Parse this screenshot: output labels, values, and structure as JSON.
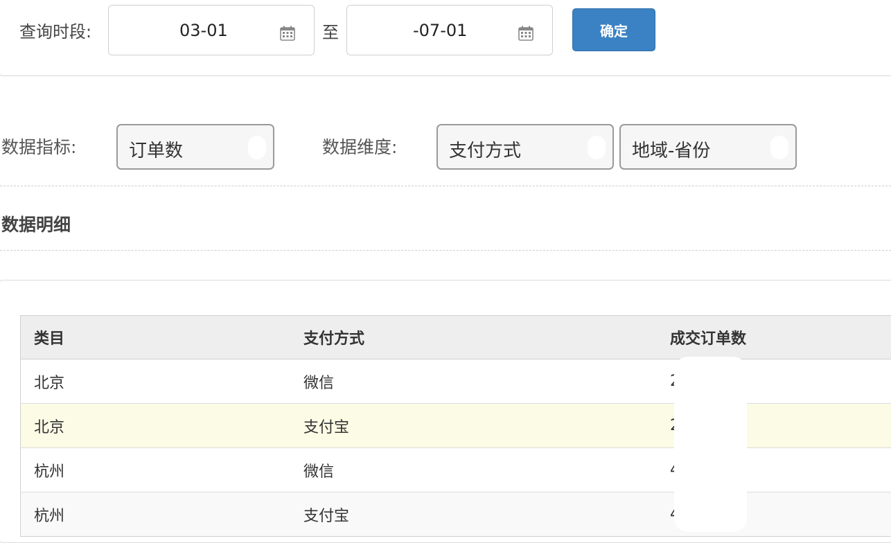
{
  "query": {
    "label": "查询时段:",
    "start_date": "03-01",
    "separator": "至",
    "end_date": "-07-01",
    "confirm_label": "确定"
  },
  "metrics": {
    "metric_label": "数据指标:",
    "metric_value": "订单数",
    "dimension_label": "数据维度:",
    "dimension_values": [
      "支付方式",
      "地域-省份"
    ]
  },
  "section_title": "数据明细",
  "table": {
    "headers": [
      "类目",
      "支付方式",
      "成交订单数"
    ],
    "rows": [
      [
        "北京",
        "微信",
        "2"
      ],
      [
        "北京",
        "支付宝",
        "2"
      ],
      [
        "杭州",
        "微信",
        "4"
      ],
      [
        "杭州",
        "支付宝",
        "4"
      ]
    ]
  },
  "colors": {
    "accent": "#3b82c4",
    "highlight_row": "#fbfbe6"
  }
}
